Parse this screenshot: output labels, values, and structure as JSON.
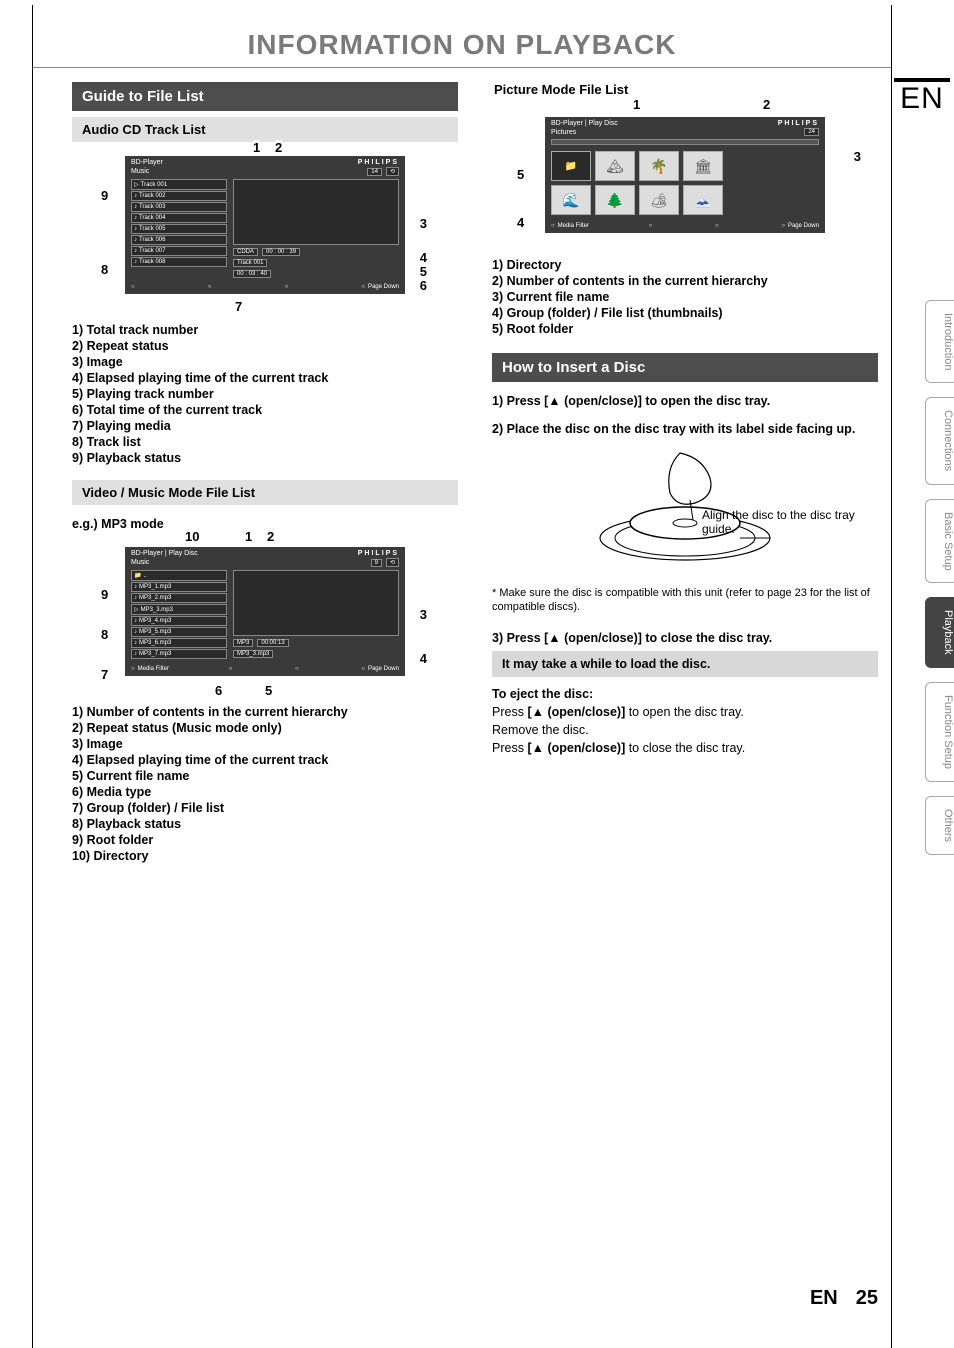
{
  "page_title": "INFORMATION ON PLAYBACK",
  "lang_code": "EN",
  "footer": {
    "lang": "EN",
    "page": "25"
  },
  "side_tabs": [
    "Introduction",
    "Connections",
    "Basic Setup",
    "Playback",
    "Function Setup",
    "Others"
  ],
  "left": {
    "section_header": "Guide to File List",
    "sub1_header": "Audio CD Track List",
    "audio_screen": {
      "breadcrumb": "BD-Player",
      "brand": "PHILIPS",
      "sub_label": "Music",
      "count_box": "14",
      "tracks": [
        "Track  001",
        "Track  002",
        "Track  003",
        "Track  004",
        "Track  005",
        "Track  006",
        "Track  007",
        "Track  008"
      ],
      "badge1": "CDDA",
      "badge2": "00 : 00 : 39",
      "badge3": "Track 001",
      "badge4": "00 : 03 : 40",
      "footer_right": "Page Down"
    },
    "audio_callouts": {
      "c1": "1",
      "c2": "2",
      "c3": "3",
      "c4": "4",
      "c5": "5",
      "c6": "6",
      "c7": "7",
      "c8": "8",
      "c9": "9"
    },
    "audio_list": [
      "1)  Total track number",
      "2)  Repeat status",
      "3)  Image",
      "4)  Elapsed playing time of the current track",
      "5)  Playing track number",
      "6)  Total time of the current track",
      "7)  Playing media",
      "8)  Track list",
      "9)  Playback status"
    ],
    "sub2_header": "Video / Music Mode File List",
    "mp3_label": "e.g.) MP3 mode",
    "mp3_screen": {
      "breadcrumb": "BD-Player | Play Disc",
      "brand": "PHILIPS",
      "sub_label": "Music",
      "count_box": "9",
      "files": [
        "..",
        "MP3_1.mp3",
        "MP3_2.mp3",
        "MP3_3.mp3",
        "MP3_4.mp3",
        "MP3_5.mp3",
        "MP3_6.mp3",
        "MP3_7.mp3"
      ],
      "badge1": "MP3",
      "badge2": "00:00:13",
      "badge3": "MP3_3.mp3",
      "footer_left": "Media Filter",
      "footer_right": "Page Down"
    },
    "mp3_callouts": {
      "c1": "1",
      "c2": "2",
      "c3": "3",
      "c4": "4",
      "c5": "5",
      "c6": "6",
      "c7": "7",
      "c8": "8",
      "c9": "9",
      "c10": "10"
    },
    "mp3_list": [
      "1)  Number of contents in the current hierarchy",
      "2)  Repeat status (Music mode only)",
      "3)  Image",
      "4)  Elapsed playing time of the current track",
      "5)  Current file name",
      "6)  Media type",
      "7)  Group (folder) / File list",
      "8)  Playback status",
      "9)  Root folder",
      "10) Directory"
    ]
  },
  "right": {
    "sub1_header": "Picture Mode File List",
    "pic_screen": {
      "breadcrumb": "BD-Player | Play Disc",
      "brand": "PHILIPS",
      "sub_label": "Pictures",
      "count_box": "24",
      "footer_left": "Media Filter",
      "footer_right": "Page Down"
    },
    "pic_callouts": {
      "c1": "1",
      "c2": "2",
      "c3": "3",
      "c4": "4",
      "c5": "5"
    },
    "pic_list": [
      "1)  Directory",
      "2)  Number of contents in the current  hierarchy",
      "3)  Current file name",
      "4)  Group (folder) / File list (thumbnails)",
      "5)  Root folder"
    ],
    "section2_header": "How to Insert a Disc",
    "step1_prefix": "1)  Press [",
    "step1_btn": "▲ (open/close)",
    "step1_suffix": "] to open the disc tray.",
    "step2": "2)  Place the disc on the disc tray with its label side facing up.",
    "disc_caption": "Align the disc to the disc tray guide.",
    "compat_note": "*  Make sure the disc is compatible with this unit (refer to page 23 for the list of compatible discs).",
    "step3_prefix": "3)  Press [",
    "step3_btn": "▲ (open/close)",
    "step3_suffix": "] to close the disc tray.",
    "load_note": "It may take a while to load the disc.",
    "eject_head": "To eject the disc:",
    "eject_l1a": "Press ",
    "eject_l1b": "[▲ (open/close)]",
    "eject_l1c": " to open the disc tray.",
    "eject_l2": "Remove the disc.",
    "eject_l3a": "Press ",
    "eject_l3b": "[▲ (open/close)]",
    "eject_l3c": " to close the disc tray."
  }
}
